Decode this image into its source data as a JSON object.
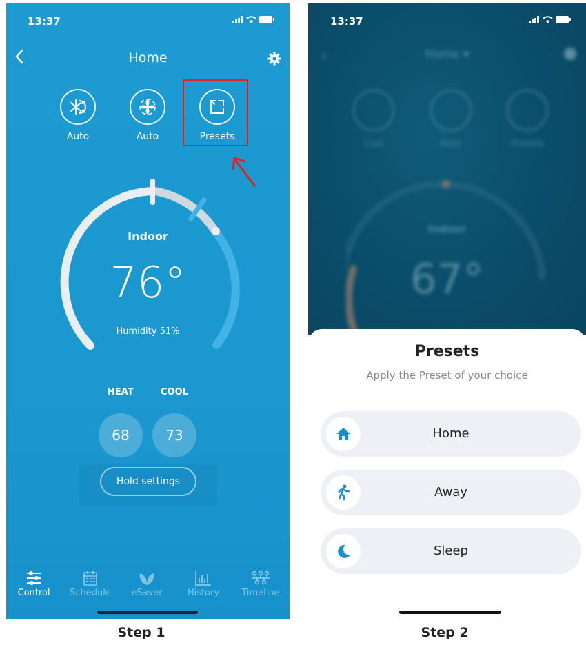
{
  "step1": {
    "status_time": "13:37",
    "title": "Home",
    "modes": [
      {
        "label": "Auto",
        "icon": "snow-sun-icon"
      },
      {
        "label": "Auto",
        "icon": "fan-icon"
      },
      {
        "label": "Presets",
        "icon": "presets-icon"
      }
    ],
    "indoor_label": "Indoor",
    "temperature": "76°",
    "humidity": "Humidity 51%",
    "heat_label": "HEAT",
    "cool_label": "COOL",
    "heat_value": "68",
    "cool_value": "73",
    "hold_label": "Hold settings",
    "nav": [
      {
        "label": "Control",
        "icon": "control-icon",
        "active": true
      },
      {
        "label": "Schedule",
        "icon": "calendar-icon",
        "active": false
      },
      {
        "label": "eSaver",
        "icon": "leaf-icon",
        "active": false
      },
      {
        "label": "History",
        "icon": "chart-icon",
        "active": false
      },
      {
        "label": "Timeline",
        "icon": "timeline-icon",
        "active": false
      }
    ],
    "caption": "Step 1"
  },
  "step2": {
    "status_time": "13:37",
    "bg_title": "Home ▾",
    "bg_modes": [
      "Cool",
      "Auto",
      "Presets"
    ],
    "bg_indoor": "Indoor",
    "bg_temperature": "67°",
    "sheet_title": "Presets",
    "sheet_subtitle": "Apply the Preset of your choice",
    "presets": [
      {
        "label": "Home",
        "icon": "home-icon"
      },
      {
        "label": "Away",
        "icon": "walking-icon"
      },
      {
        "label": "Sleep",
        "icon": "moon-icon"
      }
    ],
    "caption": "Step 2"
  },
  "colors": {
    "primary_blue": "#1c98d0",
    "highlight_red": "#e0211d",
    "preset_icon_blue": "#1a8fcc"
  }
}
